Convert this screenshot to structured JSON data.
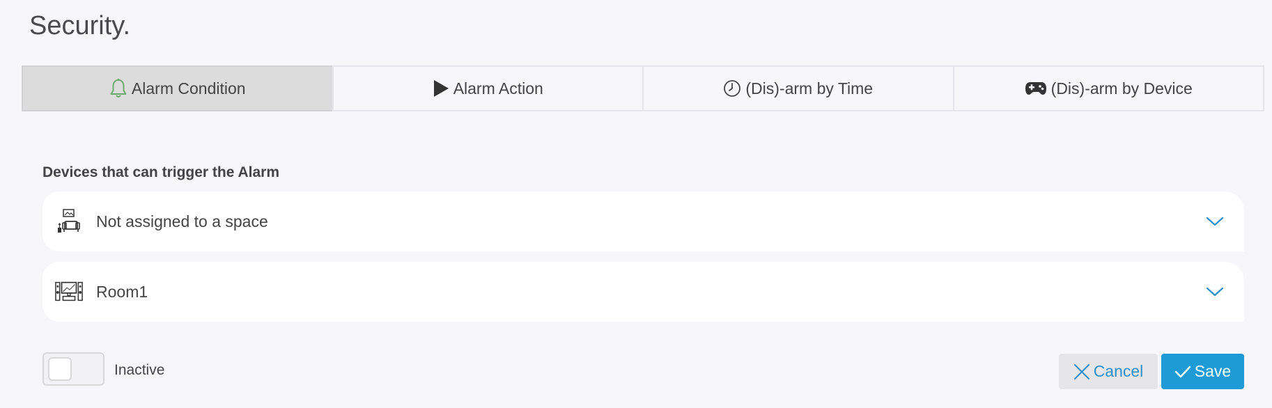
{
  "page": {
    "title": "Security."
  },
  "tabs": [
    {
      "label": "Alarm Condition",
      "icon": "bell-icon",
      "active": true
    },
    {
      "label": "Alarm Action",
      "icon": "play-icon",
      "active": false
    },
    {
      "label": "(Dis)-arm by Time",
      "icon": "clock-icon",
      "active": false
    },
    {
      "label": "(Dis)-arm by Device",
      "icon": "gamepad-icon",
      "active": false
    }
  ],
  "devices": {
    "title": "Devices that can trigger the Alarm",
    "spaces": [
      {
        "label": "Not assigned to a space",
        "icon": "living-room-icon"
      },
      {
        "label": "Room1",
        "icon": "tv-room-icon"
      }
    ]
  },
  "status": {
    "label": "Inactive",
    "active": false
  },
  "actions": {
    "cancel_label": "Cancel",
    "save_label": "Save"
  },
  "colors": {
    "accent": "#1e9ad6",
    "bell": "#6aaa6a",
    "active_tab": "#dcdcdc",
    "background": "#f7f7fa"
  }
}
